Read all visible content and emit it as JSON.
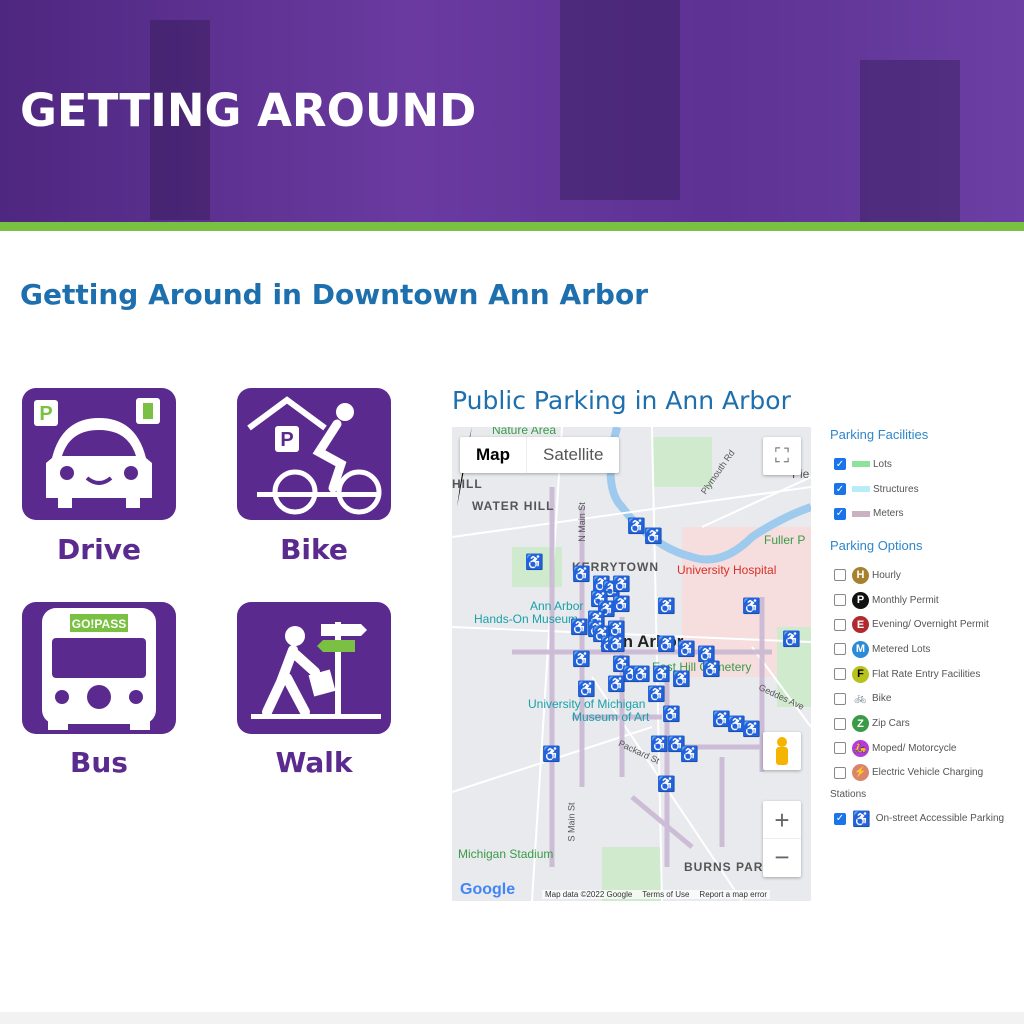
{
  "hero": {
    "title": "GETTING AROUND",
    "bg_color": "#5b2f90",
    "bar_color": "#7ac143"
  },
  "section_title": "Getting Around in Downtown Ann Arbor",
  "tiles": [
    {
      "label": "Drive",
      "icon": "car-parking-icon"
    },
    {
      "label": "Bike",
      "icon": "bike-parking-icon"
    },
    {
      "label": "Bus",
      "icon": "bus-gopass-icon",
      "badge": "GO!PASS"
    },
    {
      "label": "Walk",
      "icon": "pedestrian-sign-icon"
    }
  ],
  "map": {
    "title": "Public Parking in Ann Arbor",
    "type_buttons": [
      "Map",
      "Satellite"
    ],
    "labels": [
      "Nature Area",
      "HILL",
      "WATER HILL",
      "N Main St",
      "Plymouth Rd",
      "Fuller P",
      "KERRYTOWN",
      "University Hospital",
      "Ann Arbor",
      "Hands-On Museum",
      "Ann Arbor",
      "East Hill Cemetery",
      "Geddes Ave",
      "University of Michigan",
      "Museum of Art",
      "Packard St",
      "S Main St",
      "Michigan Stadium",
      "BURNS PARK",
      "Pie"
    ],
    "attribution": [
      "Map data ©2022 Google",
      "Terms of Use",
      "Report a map error"
    ],
    "google_logo": "Google",
    "zoom_in": "+",
    "zoom_out": "−"
  },
  "legend": {
    "facilities_title": "Parking Facilities",
    "facilities": [
      {
        "label": "Lots",
        "checked": true,
        "color": "#8de39a"
      },
      {
        "label": "Structures",
        "checked": true,
        "color": "#b8ecf7"
      },
      {
        "label": "Meters",
        "checked": true,
        "color": "#c9b3c3"
      }
    ],
    "options_title": "Parking Options",
    "options": [
      {
        "label": "Hourly",
        "letter": "H",
        "color": "#a8812e",
        "checked": false
      },
      {
        "label": "Monthly Permit",
        "letter": "P",
        "color": "#111111",
        "checked": false
      },
      {
        "label": "Evening/ Overnight Permit",
        "letter": "E",
        "color": "#b02a30",
        "checked": false
      },
      {
        "label": "Metered Lots",
        "letter": "M",
        "color": "#2b8bd6",
        "checked": false
      },
      {
        "label": "Flat Rate Entry Facilities",
        "letter": "F",
        "color": "#b8c21e",
        "checked": false
      },
      {
        "label": "Bike",
        "letter": "",
        "color": "#222222",
        "checked": false
      },
      {
        "label": "Zip Cars",
        "letter": "Z",
        "color": "#3a9a48",
        "checked": false
      },
      {
        "label": "Moped/ Motorcycle",
        "letter": "",
        "color": "#b43bd9",
        "checked": false
      },
      {
        "label": "Electric Vehicle Charging",
        "letter": "",
        "color": "#d9856e",
        "checked": false
      }
    ],
    "stations_title": "Stations",
    "stations": [
      {
        "label": "On-street Accessible Parking",
        "checked": true,
        "color": "#142a6e"
      }
    ]
  }
}
